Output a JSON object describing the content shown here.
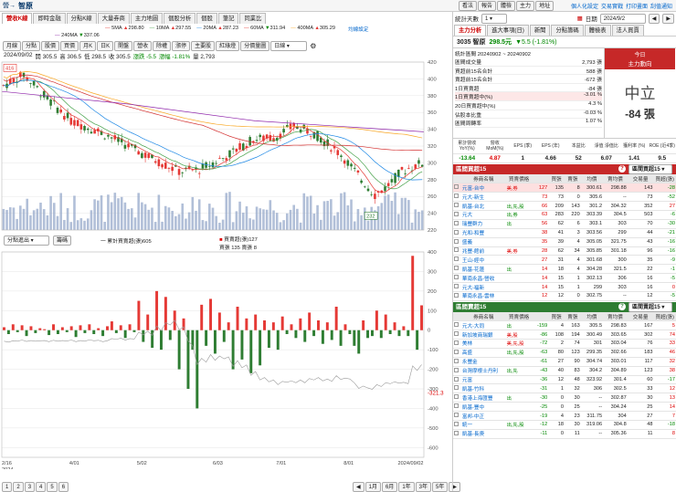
{
  "topbar": {
    "breadcrumb": "營→",
    "title": "智原",
    "links": [
      "看法",
      "報告",
      "體檢",
      "主力",
      "地址"
    ],
    "right_links": [
      "個人化設定",
      "交易實戰",
      "打印畫面",
      "刮值通知"
    ],
    "arrow_glyph": "◀▶"
  },
  "left_tabs": [
    "營收K線",
    "即時金融",
    "分點K線",
    "大量券商",
    "主力地圖",
    "個股分析",
    "個股",
    "筆記",
    "同業比"
  ],
  "ma_line1": [
    {
      "label": "5MA",
      "value": "298.80",
      "color": "#e53935"
    },
    {
      "label": "10MA",
      "value": "297.55",
      "color": "#43a047"
    },
    {
      "label": "20MA",
      "value": "287.23",
      "color": "#1e88e5"
    },
    {
      "label": "60MA",
      "value": "311.94",
      "color": "#e53935"
    },
    {
      "label": "400MA",
      "value": "305.29",
      "color": "#f9a825"
    }
  ],
  "ma_line2": {
    "label": "240MA",
    "value": "337.06",
    "color": "#8e24aa"
  },
  "ma_link": "均線設定",
  "toolbar": [
    "月線",
    "分點",
    "股價",
    "買價",
    "月K",
    "日K",
    "開盤",
    "營收",
    "除權",
    "漲停",
    "主要股",
    "紅綠燈",
    "分價量圖"
  ],
  "period_select": "日線",
  "ohlc": {
    "date": "2024/09/02",
    "open_label": "開",
    "open": "305.5",
    "high_label": "高",
    "high": "306.5",
    "low_label": "低",
    "low": "298.5",
    "close_label": "收",
    "close": "305.5",
    "chg_label": "漲跌",
    "chg": "-5.5",
    "pct_label": "漲幅",
    "pct": "-1.81%",
    "vol_label": "量",
    "vol": "2,793"
  },
  "price_axis": [
    "420",
    "400",
    "380",
    "360",
    "340",
    "320",
    "300",
    "280",
    "260",
    "240",
    "220"
  ],
  "price_tag_high": "416",
  "price_tag_low": "232",
  "lower_select": "分點進出",
  "lower_btn": "籌碼",
  "lower_legend": {
    "l1": "一 累計買賣超(張)605",
    "l2": "買賣超(張)127",
    "l3": "買張 135 賣張 8"
  },
  "lower_axis": [
    "400",
    "300",
    "200",
    "100",
    "0",
    "-100",
    "-200",
    "-300",
    "-400",
    "-500",
    "-600"
  ],
  "lower_tag": "-321.3",
  "x_labels": [
    "2/16\n2024",
    "4/01",
    "5/02",
    "6/03",
    "7/01",
    "8/01",
    "2024/09/02"
  ],
  "pager": [
    "1",
    "2",
    "3",
    "4",
    "5",
    "6"
  ],
  "range_btns": [
    "1月",
    "6月",
    "1年",
    "3年",
    "5年"
  ],
  "right": {
    "sort_label": "統計天數",
    "sort_value": "1",
    "date_label": "日期",
    "date_value": "2024/9/2",
    "tabs": [
      "主力分析",
      "進大事項(日)",
      "新聞",
      "分點籌碼",
      "體檢表",
      "法人買賣"
    ],
    "stock_code": "3035 智原",
    "price": "298.5元",
    "change": "▼5.5 (-1.81%)",
    "period": "統計區間 20240902 ~ 20240902",
    "stats": [
      [
        "區間成交量",
        "2,793 張"
      ],
      [
        "買超前15名合計",
        "588 張"
      ],
      [
        "賣超前15名合計",
        "-672 張"
      ],
      [
        "1日買賣超",
        "-84 張"
      ],
      [
        "1日買賣超中(%)",
        "-3.01 %"
      ],
      [
        "20日買賣超中(%)",
        "4.3 %"
      ],
      [
        "佔股本比重",
        "-0.03 %"
      ],
      [
        "區間周轉率",
        "1.07 %"
      ]
    ],
    "trend_title": "今日",
    "trend_sub": "主力動向",
    "trend_word": "中立",
    "trend_value": "-84 張",
    "metrics_head": [
      "累計營收 YoY(%)",
      "營收 MoM(%)",
      "EPS (季)",
      "EPS (年)",
      "本益比",
      "淨值 淨值比",
      "獲利率 (%)",
      "ROE (近4季)"
    ],
    "metrics_val": [
      "-13.64",
      "4.87",
      "1",
      "4.66",
      "52",
      "6.07",
      "1.41",
      "9.5"
    ],
    "buy_title": "區間買超15",
    "buy_select": "區間買超15",
    "sell_title": "區間賣超15",
    "sell_select": "區間賣超15",
    "cols": [
      "券商名稱",
      "買賣價格",
      "買張",
      "賣張",
      "均價",
      "賣均價",
      "交易量",
      "買超(張)"
    ],
    "buy_rows": [
      [
        "元富-台中",
        "美,券",
        "127",
        "135",
        "8",
        "300.61",
        "298.88",
        "143",
        "-28"
      ],
      [
        "元大-新生",
        "",
        "73",
        "73",
        "0",
        "305.6",
        "--",
        "73",
        "-52"
      ],
      [
        "凱基-台北",
        "出,先,股",
        "66",
        "209",
        "143",
        "301.2",
        "304.32",
        "352",
        "27"
      ],
      [
        "元大",
        "出,券",
        "63",
        "283",
        "220",
        "303.39",
        "304.5",
        "503",
        "-6"
      ],
      [
        "瑞豐群力",
        "出",
        "56",
        "62",
        "6",
        "303.1",
        "303",
        "70",
        "-30"
      ],
      [
        "光和-和豐",
        "",
        "38",
        "41",
        "3",
        "303.56",
        "299",
        "44",
        "-21"
      ],
      [
        "盛義",
        "",
        "35",
        "39",
        "4",
        "305.05",
        "321.75",
        "43",
        "-16"
      ],
      [
        "兆豐-館前",
        "美,券",
        "28",
        "62",
        "34",
        "305.85",
        "301.18",
        "96",
        "-16"
      ],
      [
        "王山-經中",
        "",
        "27",
        "31",
        "4",
        "301.68",
        "300",
        "35",
        "-9"
      ],
      [
        "凱基-花蓮",
        "出",
        "14",
        "18",
        "4",
        "304.28",
        "321.5",
        "22",
        "-1"
      ],
      [
        "華南永昌-營收",
        "",
        "14",
        "15",
        "1",
        "302.13",
        "306",
        "16",
        "-5"
      ],
      [
        "元大-福新",
        "",
        "14",
        "15",
        "1",
        "299",
        "303",
        "16",
        "0"
      ],
      [
        "華南永昌-雲林",
        "",
        "12",
        "12",
        "0",
        "302.75",
        "--",
        "12",
        "-5"
      ]
    ],
    "sell_rows": [
      [
        "元大-大同",
        "出",
        "-159",
        "4",
        "163",
        "305.5",
        "298.83",
        "167",
        "5"
      ],
      [
        "新加坡商瑞銀",
        "美,股",
        "-86",
        "108",
        "194",
        "300.49",
        "303.65",
        "302",
        "74"
      ],
      [
        "美林",
        "美,先,股",
        "-72",
        "2",
        "74",
        "301",
        "303.04",
        "76",
        "33"
      ],
      [
        "高盛",
        "出,先,股",
        "-63",
        "80",
        "123",
        "299.35",
        "302.66",
        "183",
        "46"
      ],
      [
        "永豐金",
        "",
        "-61",
        "27",
        "90",
        "304.74",
        "303.01",
        "117",
        "32"
      ],
      [
        "台灣摩根士丹利",
        "出,先",
        "-43",
        "40",
        "83",
        "304.2",
        "304.89",
        "123",
        "38"
      ],
      [
        "元富",
        "",
        "-36",
        "12",
        "48",
        "323.92",
        "301.4",
        "60",
        "-17"
      ],
      [
        "凱基-竹科",
        "",
        "-31",
        "1",
        "32",
        "306",
        "302.5",
        "33",
        "12"
      ],
      [
        "香港上海匯豐",
        "出",
        "-30",
        "0",
        "30",
        "--",
        "302.87",
        "30",
        "13"
      ],
      [
        "凱基-豐中",
        "",
        "-25",
        "0",
        "25",
        "--",
        "304.24",
        "25",
        "14"
      ],
      [
        "富邦-中正",
        "",
        "-19",
        "4",
        "23",
        "311.75",
        "304",
        "27",
        "7"
      ],
      [
        "統一",
        "出,先,股",
        "-12",
        "18",
        "30",
        "319.06",
        "304.8",
        "48",
        "-18"
      ],
      [
        "凱基-長庚",
        "",
        "-11",
        "0",
        "11",
        "--",
        "305.36",
        "11",
        "8"
      ]
    ]
  },
  "chart_data": {
    "type": "candlestick",
    "ylim": [
      220,
      420
    ],
    "lower_ylim": [
      -650,
      400
    ],
    "net_buy_sell": [
      15,
      -20,
      30,
      -10,
      25,
      -30,
      20,
      -15,
      10,
      5,
      -25,
      30,
      -20,
      15,
      -10,
      20,
      -35,
      25,
      -15,
      30,
      -20,
      10,
      -30,
      20,
      45,
      -15,
      25,
      -40,
      30,
      -10,
      150,
      -60,
      80,
      -90,
      200,
      -100,
      170,
      -50,
      100,
      -200,
      60,
      -300,
      -100,
      -400,
      130,
      -80,
      160,
      -120,
      90,
      -60,
      40,
      -200,
      120,
      -150,
      60,
      -220,
      80,
      -180,
      50,
      -90,
      40,
      -100,
      70,
      -20,
      30,
      -40,
      60,
      -60,
      90,
      -30,
      50,
      -70,
      40,
      -50,
      120,
      -80,
      30,
      -20,
      -80,
      -120,
      50,
      -40,
      -30,
      100,
      -40,
      80,
      -20,
      40,
      -30,
      20,
      -30,
      380,
      -100,
      127
    ]
  }
}
